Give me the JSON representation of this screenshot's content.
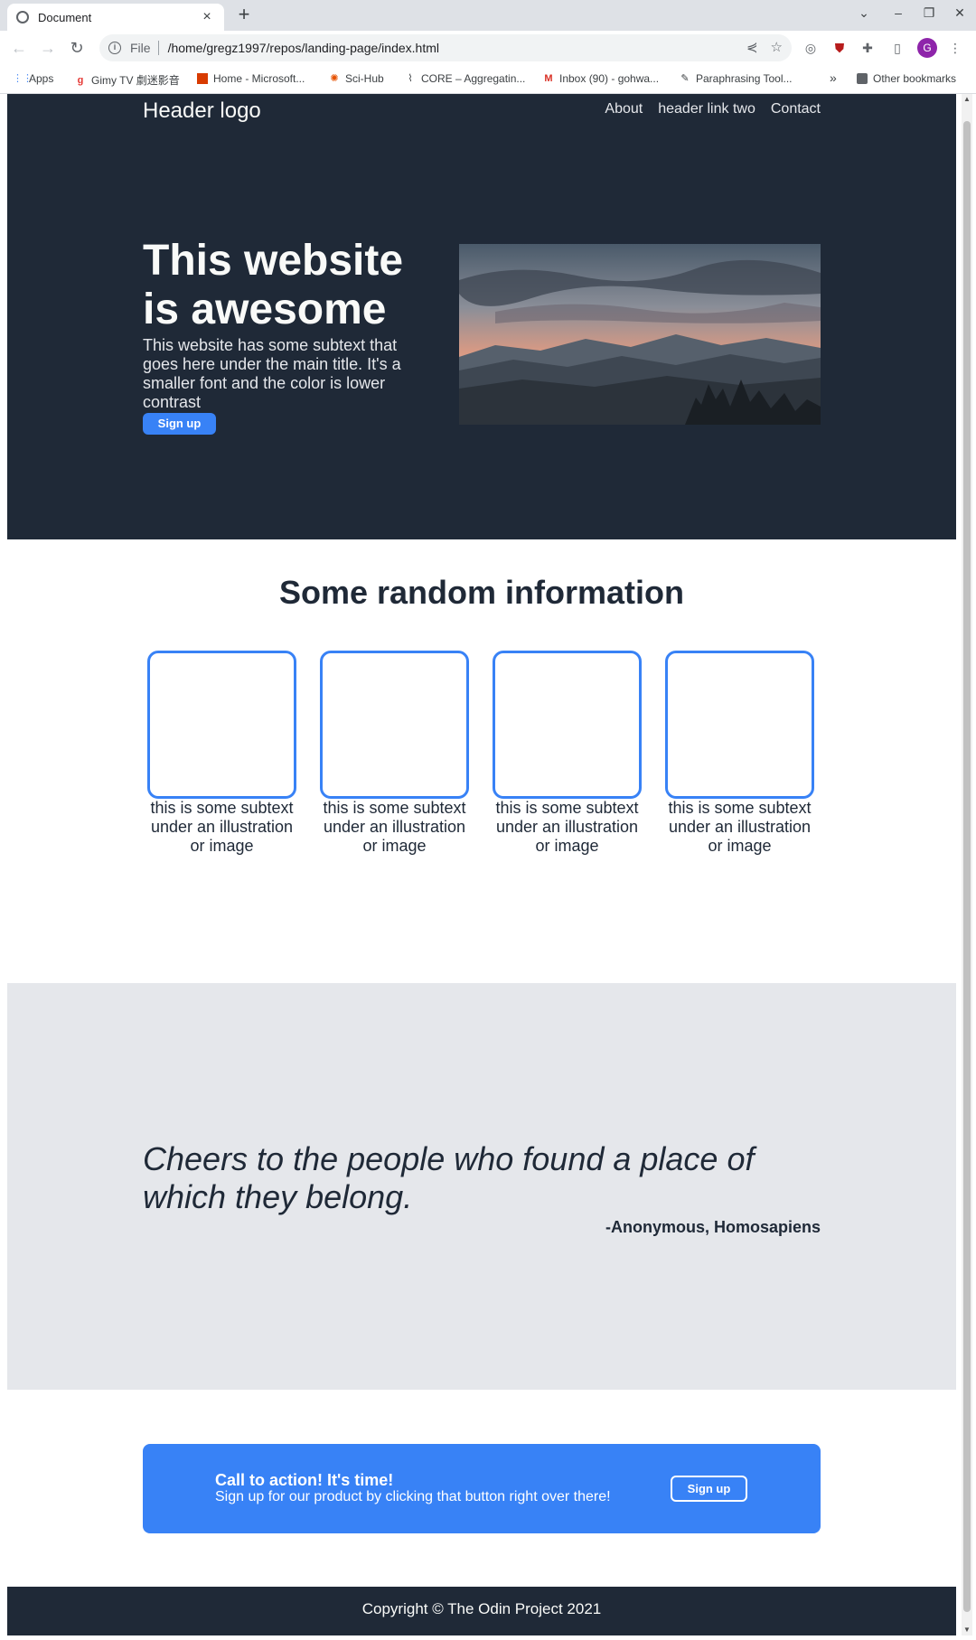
{
  "browser": {
    "tab_title": "Document",
    "tab_close_icon": "×",
    "new_tab_icon": "+",
    "scheme": "File",
    "url": "/home/gregz1997/repos/landing-page/index.html",
    "profile_initial": "G",
    "bookmarks": [
      {
        "label": "Apps",
        "icon": "apps-grid-icon"
      },
      {
        "label": "Gimy TV 劇迷影音",
        "icon": "gimy-icon"
      },
      {
        "label": "Home - Microsoft...",
        "icon": "office-icon"
      },
      {
        "label": "Sci-Hub",
        "icon": "scihub-icon"
      },
      {
        "label": "CORE – Aggregatin...",
        "icon": "core-icon"
      },
      {
        "label": "Inbox (90) - gohwa...",
        "icon": "gmail-icon"
      },
      {
        "label": "Paraphrasing Tool...",
        "icon": "quill-icon"
      }
    ],
    "bookmarks_overflow": "»",
    "other_bookmarks": "Other bookmarks"
  },
  "header": {
    "logo": "Header logo",
    "links": [
      "About",
      "header link two",
      "Contact"
    ]
  },
  "hero": {
    "title": "This website is awesome",
    "subtitle": "This website has some subtext that goes here under the main title. It's a smaller font and the color is lower contrast",
    "button": "Sign up"
  },
  "info": {
    "title": "Some random information",
    "cards": [
      {
        "text": "this is some subtext under an illustration or image"
      },
      {
        "text": "this is some subtext under an illustration or image"
      },
      {
        "text": "this is some subtext under an illustration or image"
      },
      {
        "text": "this is some subtext under an illustration or image"
      }
    ]
  },
  "quote": {
    "text": "Cheers to the people who found a place of which they belong.",
    "author": "-Anonymous, Homosapiens"
  },
  "cta": {
    "title": "Call to action! It's time!",
    "text": "Sign up for our product by clicking that button right over there!",
    "button": "Sign up"
  },
  "footer": {
    "text": "Copyright © The Odin Project 2021"
  },
  "colors": {
    "dark": "#1f2937",
    "accent": "#3882f6",
    "light_gray": "#e5e7eb"
  }
}
